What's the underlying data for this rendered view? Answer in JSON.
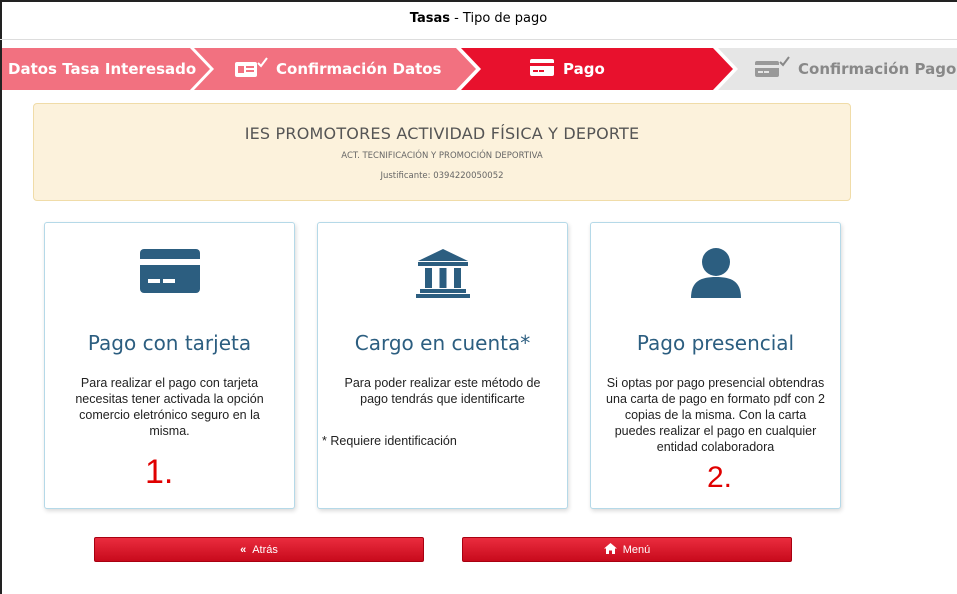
{
  "window": {
    "title_bold": "Tasas",
    "title_rest": " - Tipo de pago"
  },
  "stepper": {
    "steps": [
      {
        "label": "Datos Tasa Interesado",
        "state": "done",
        "color": "#f27180"
      },
      {
        "label": "Confirmación Datos",
        "state": "done",
        "icon": "id-card-check-icon",
        "color": "#f27180"
      },
      {
        "label": "Pago",
        "state": "active",
        "icon": "credit-card-icon",
        "color": "#e8112d"
      },
      {
        "label": "Confirmación Pago",
        "state": "pending",
        "icon": "credit-card-check-icon",
        "color": "#e6e6e6"
      }
    ]
  },
  "info": {
    "center_name": "IES PROMOTORES ACTIVIDAD FÍSICA Y DEPORTE",
    "activity": "ACT. TECNIFICACIÓN Y PROMOCIÓN DEPORTIVA",
    "reference": "Justificante: 0394220050052"
  },
  "options": [
    {
      "icon": "credit-card-icon",
      "title": "Pago con tarjeta",
      "description": "Para realizar el pago con tarjeta necesitas tener activada la opción comercio eletrónico seguro en la misma.",
      "annotation": "1."
    },
    {
      "icon": "bank-icon",
      "title": "Cargo en cuenta*",
      "description": "Para poder realizar este método de pago tendrás que identificarte",
      "note": "* Requiere identificación"
    },
    {
      "icon": "user-icon",
      "title": "Pago presencial",
      "description": "Si optas por pago presencial obtendras una carta de pago en formato pdf con 2 copias de la misma. Con la carta puedes realizar el pago en cualquier entidad colaboradora",
      "annotation": "2."
    }
  ],
  "buttons": {
    "back_icon": "«",
    "back_label": "Atrás",
    "menu_icon": "home-icon",
    "menu_label": "Menú"
  },
  "colors": {
    "accent": "#e8112d",
    "icon": "#2c5e80",
    "info_bg": "#fcf2dc"
  }
}
